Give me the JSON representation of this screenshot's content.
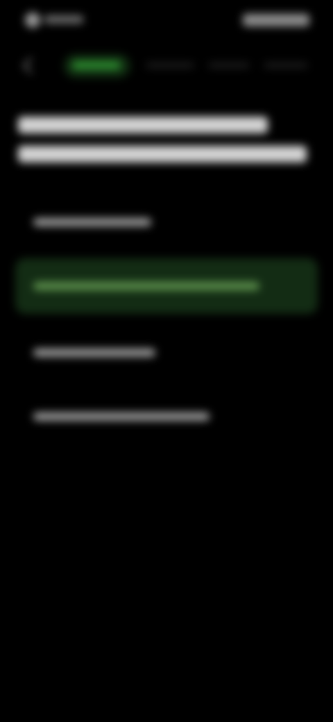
{
  "status_bar": {
    "left_icon": "status-dot-icon"
  },
  "tabs": {
    "back_icon": "chevron-left-icon",
    "count": 4,
    "active_index": 0
  },
  "question": {
    "line_count": 2
  },
  "options": {
    "count": 4,
    "selected_index": 1
  },
  "colors": {
    "background": "#000000",
    "accent": "#2c8a2e",
    "selected_fill": "#132c14",
    "text": "#d4d4d4"
  }
}
